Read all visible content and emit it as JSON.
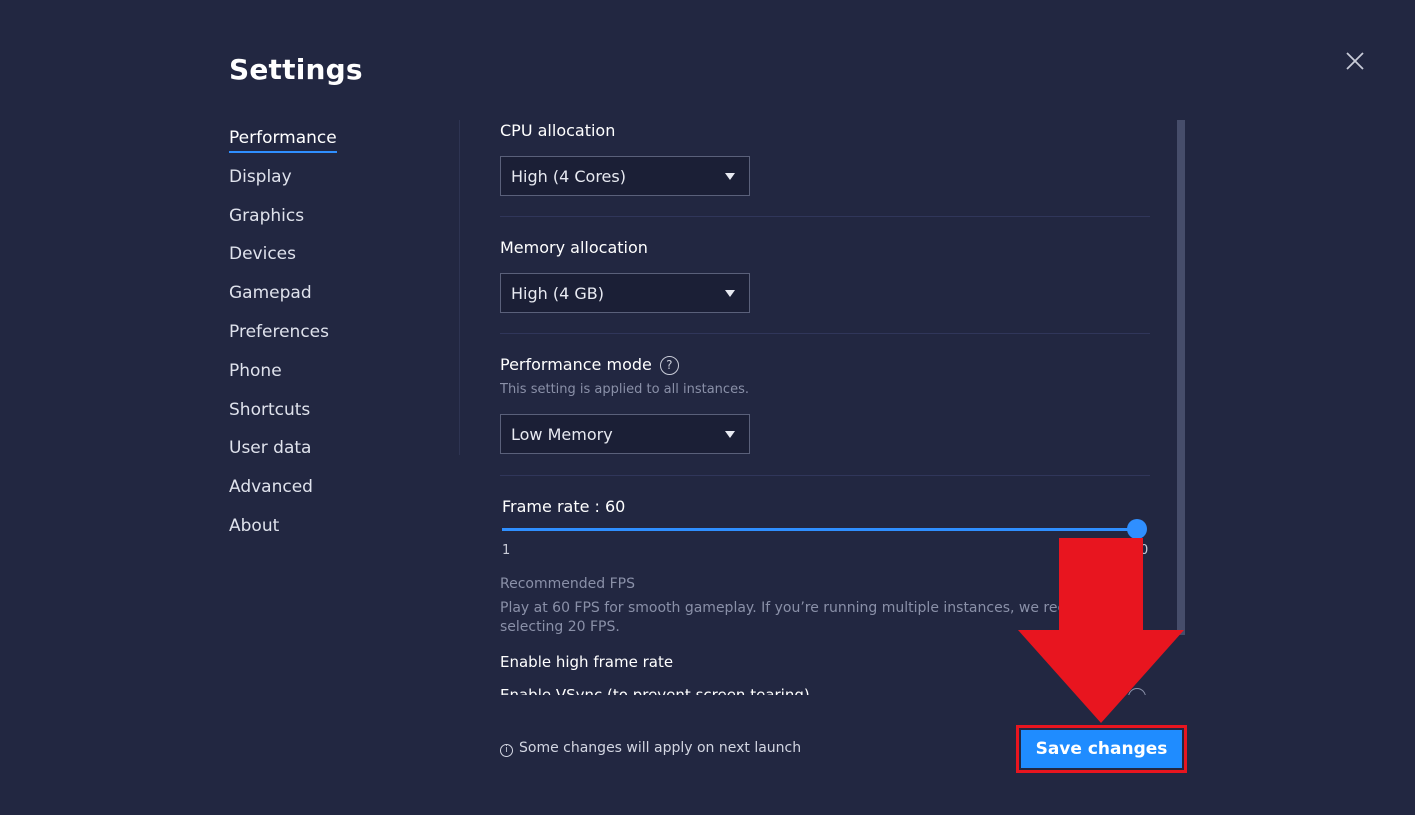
{
  "window": {
    "title": "Settings"
  },
  "sidebar": {
    "items": [
      {
        "label": "Performance",
        "active": true
      },
      {
        "label": "Display"
      },
      {
        "label": "Graphics"
      },
      {
        "label": "Devices"
      },
      {
        "label": "Gamepad"
      },
      {
        "label": "Preferences"
      },
      {
        "label": "Phone"
      },
      {
        "label": "Shortcuts"
      },
      {
        "label": "User data"
      },
      {
        "label": "Advanced"
      },
      {
        "label": "About"
      }
    ]
  },
  "performance": {
    "cpu": {
      "label": "CPU allocation",
      "value": "High (4 Cores)"
    },
    "memory": {
      "label": "Memory allocation",
      "value": "High (4 GB)"
    },
    "mode": {
      "label": "Performance mode",
      "help_icon": "?",
      "hint": "This setting is applied to all instances.",
      "value": "Low Memory"
    },
    "frame_rate": {
      "label": "Frame rate : 60",
      "value": 60,
      "min_label": "1",
      "max_label_visible": "0"
    },
    "recommended": {
      "title": "Recommended FPS",
      "line1": "Play at 60 FPS for smooth gameplay. If you’re running multiple instances, we reco",
      "line2": "selecting 20 FPS."
    },
    "high_frame_rate": {
      "label": "Enable high frame rate"
    },
    "vsync": {
      "label": "Enable VSync (to prevent screen tearing)"
    }
  },
  "footer": {
    "info_icon": "i",
    "note": "Some changes will apply on next launch",
    "save_label": "Save changes"
  },
  "colors": {
    "background": "#222741",
    "accent": "#1f8cff",
    "highlight": "#e8151f"
  }
}
